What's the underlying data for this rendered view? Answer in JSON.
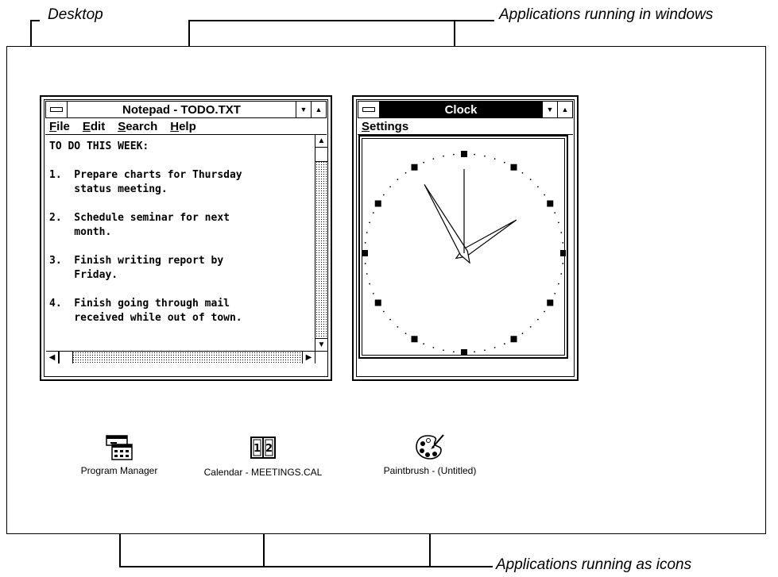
{
  "callouts": {
    "desktop": "Desktop",
    "windows": "Applications running in windows",
    "icons": "Applications running as icons"
  },
  "notepad": {
    "title": "Notepad - TODO.TXT",
    "menu": [
      "File",
      "Edit",
      "Search",
      "Help"
    ],
    "text_lines": [
      "TO DO THIS WEEK:",
      "",
      "1.  Prepare charts for Thursday",
      "    status meeting.",
      "",
      "2.  Schedule seminar for next",
      "    month.",
      "",
      "3.  Finish writing report by",
      "    Friday.",
      "",
      "4.  Finish going through mail",
      "    received while out of town."
    ]
  },
  "clock": {
    "title": "Clock",
    "menu": [
      "Settings"
    ],
    "time": {
      "hour": 1,
      "minute": 55,
      "second": 0
    }
  },
  "icons": [
    {
      "label": "Program Manager",
      "icon": "program-manager-icon"
    },
    {
      "label": "Calendar - MEETINGS.CAL",
      "icon": "calendar-icon"
    },
    {
      "label": "Paintbrush - (Untitled)",
      "icon": "paintbrush-icon"
    }
  ]
}
